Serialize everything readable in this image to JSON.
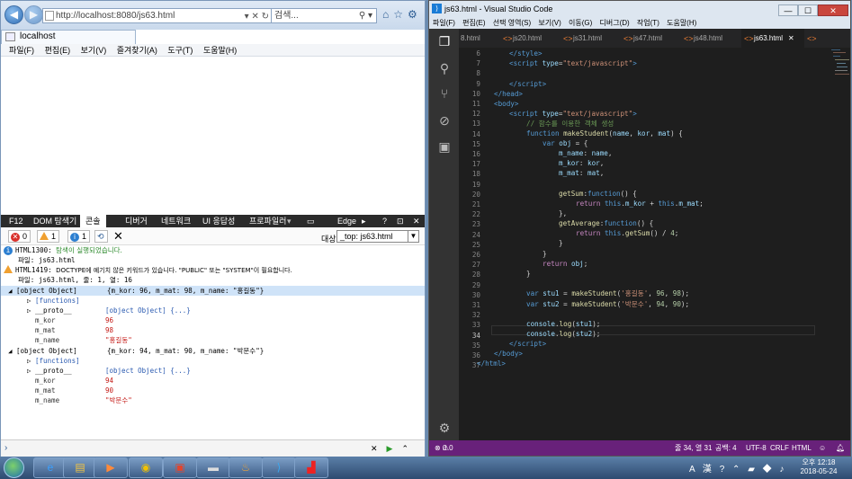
{
  "ie": {
    "address": "http://localhost:8080/js63.html",
    "address_host": "localhost",
    "search_placeholder": "검색...",
    "tab_title": "localhost",
    "menu": [
      "파일(F)",
      "편집(E)",
      "보기(V)",
      "즐겨찾기(A)",
      "도구(T)",
      "도움말(H)"
    ],
    "devtools": {
      "tabs": [
        "F12",
        "DOM 탐색기",
        "콘솔",
        "디버거",
        "네트워크",
        "UI 응답성",
        "프로파일러",
        "Edge"
      ],
      "active_tab": "콘솔",
      "error_count": "0",
      "warning_count": "1",
      "info_count": "1",
      "target_label": "대상:",
      "target_value": "_top: js63.html",
      "messages": [
        {
          "type": "info",
          "code": "HTML1300:",
          "text": "탐색이 실행되었습니다.",
          "file": "파일: js63.html"
        },
        {
          "type": "warning",
          "code": "HTML1419:",
          "text": "DOCTYPE에 예기치 않은 키워드가 있습니다. \"PUBLIC\" 또는 \"SYSTEM\"이 필요합니다.",
          "file": "파일: js63.html, 줄: 1, 열: 16"
        }
      ],
      "objects": [
        {
          "label": "[object Object]",
          "summary": "{m_kor: 96, m_mat: 98, m_name: \"홍길동\"}",
          "functions": "[functions]",
          "proto": "__proto__",
          "proto_val": "[object Object] {...}",
          "props": [
            {
              "k": "m_kor",
              "v": "96"
            },
            {
              "k": "m_mat",
              "v": "98"
            },
            {
              "k": "m_name",
              "v": "\"홍길동\""
            }
          ]
        },
        {
          "label": "[object Object]",
          "summary": "{m_kor: 94, m_mat: 90, m_name: \"박문수\"}",
          "functions": "[functions]",
          "proto": "__proto__",
          "proto_val": "[object Object] {...}",
          "props": [
            {
              "k": "m_kor",
              "v": "94"
            },
            {
              "k": "m_mat",
              "v": "90"
            },
            {
              "k": "m_name",
              "v": "\"박문수\""
            }
          ]
        }
      ]
    }
  },
  "vscode": {
    "title": "js63.html - Visual Studio Code",
    "menu": [
      "파일(F)",
      "편집(E)",
      "선택 영역(S)",
      "보기(V)",
      "이동(G)",
      "디버그(D)",
      "작업(T)",
      "도움말(H)"
    ],
    "tabs": [
      "8.html",
      "js20.html",
      "js31.html",
      "js47.html",
      "js48.html",
      "js63.html"
    ],
    "active_tab": "js63.html",
    "line_numbers": [
      "6",
      "7",
      "8",
      "9",
      "10",
      "11",
      "12",
      "13",
      "14",
      "15",
      "16",
      "17",
      "18",
      "19",
      "20",
      "21",
      "22",
      "23",
      "24",
      "25",
      "26",
      "27",
      "28",
      "29",
      "30",
      "31",
      "32",
      "33",
      "34",
      "35",
      "36",
      "37"
    ],
    "status": {
      "errors": "0",
      "warnings": "0",
      "position": "줄 34, 열 31",
      "spaces": "공백: 4",
      "encoding": "UTF-8",
      "eol": "CRLF",
      "language": "HTML"
    }
  },
  "taskbar": {
    "time": "오후 12:18",
    "date": "2018-05-24",
    "ime": "A 漢"
  },
  "colors": {
    "vscode_status": "#68217a",
    "editor_bg": "#1e1e1e",
    "devtools_tabbar": "#2b2b2b"
  }
}
